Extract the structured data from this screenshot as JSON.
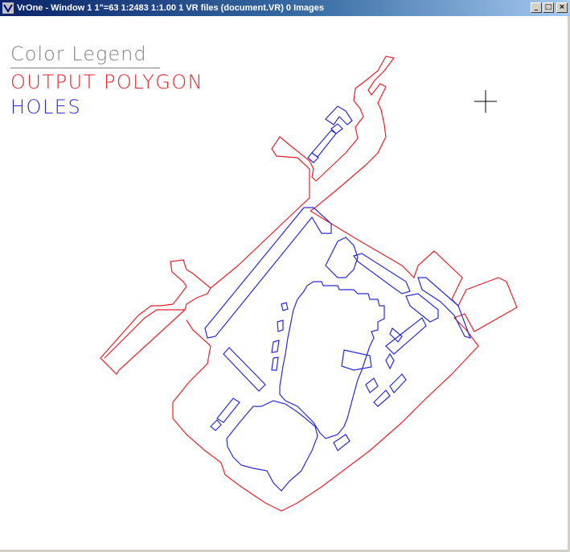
{
  "window": {
    "title": "VrOne - Window 1   1\"=63   1:2483   1:1.00   1 VR files (document.VR)   0 Images",
    "minimize_label": "_",
    "maximize_label": "□",
    "close_label": "×"
  },
  "legend": {
    "title": "Color Legend",
    "items": [
      {
        "label": "OUTPUT POLYGON",
        "color": "#e8202a"
      },
      {
        "label": "HOLES",
        "color": "#2a2ad6"
      }
    ]
  },
  "colors": {
    "output_polygon": "#e8202a",
    "holes": "#2a2ad6",
    "cursor": "#000000"
  },
  "icons": {
    "app": "vrone-app-icon",
    "cursor": "crosshair-icon"
  }
}
